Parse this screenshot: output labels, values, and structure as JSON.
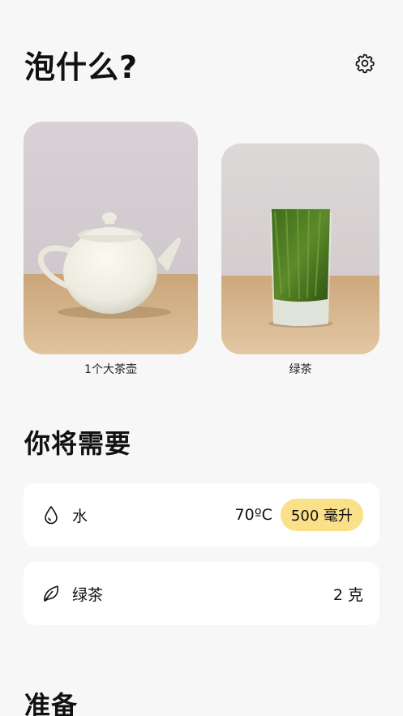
{
  "header": {
    "title": "泡什么?",
    "settings_icon": "gear-icon"
  },
  "vessels": [
    {
      "caption": "1个大茶壶",
      "image": "white-teapot-photo"
    },
    {
      "caption": "绿茶",
      "image": "green-tea-glass-photo"
    }
  ],
  "needs": {
    "title": "你将需要",
    "items": [
      {
        "icon": "water-drop-icon",
        "label": "水",
        "value": "70ºC",
        "pill": "500 毫升"
      },
      {
        "icon": "leaf-icon",
        "label": "绿茶",
        "value": "2 克"
      }
    ]
  },
  "prepare": {
    "title": "准备"
  },
  "colors": {
    "background": "#f7f7f7",
    "card": "#ffffff",
    "pill": "#fbe08a"
  }
}
